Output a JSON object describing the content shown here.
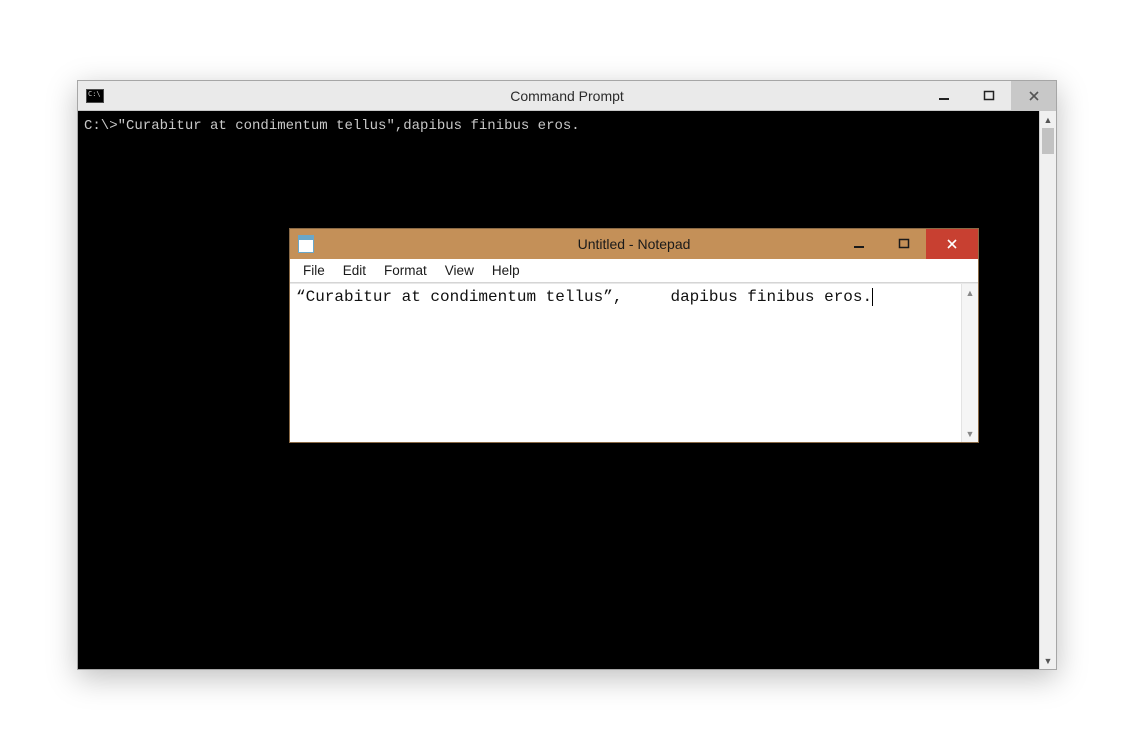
{
  "cmd": {
    "title": "Command Prompt",
    "output": "C:\\>\"Curabitur at condimentum tellus\",dapibus finibus eros."
  },
  "notepad": {
    "title": "Untitled - Notepad",
    "menu": {
      "file": "File",
      "edit": "Edit",
      "format": "Format",
      "view": "View",
      "help": "Help"
    },
    "content": "“Curabitur at condimentum tellus”,     dapibus finibus eros."
  }
}
